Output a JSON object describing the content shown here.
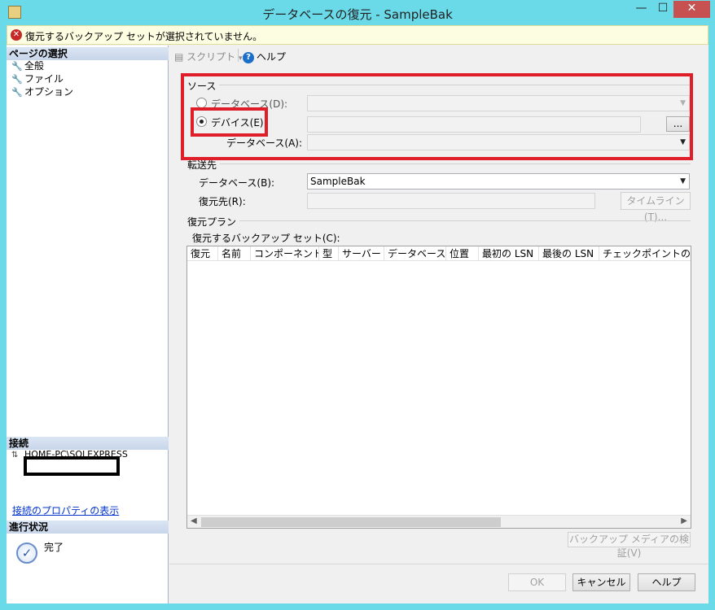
{
  "window": {
    "title": "データベースの復元 - SampleBak",
    "minimize_glyph": "—",
    "maximize_glyph": "☐",
    "close_glyph": "✕"
  },
  "error": {
    "icon": "error-icon",
    "message": "復元するバックアップ セットが選択されていません。"
  },
  "left": {
    "page_select_header": "ページの選択",
    "pages": [
      "全般",
      "ファイル",
      "オプション"
    ],
    "connection_header": "接続",
    "server": "HOME-PC\\SQLEXPRESS",
    "view_conn_props": "接続のプロパティの表示",
    "progress_header": "進行状況",
    "progress_status": "完了"
  },
  "toolbar": {
    "script_label": "スクリプト",
    "help_label": "ヘルプ"
  },
  "source": {
    "section": "ソース",
    "database_radio": "データベース(D):",
    "device_radio": "デバイス(E):",
    "browse_label": "...",
    "device_database_label": "データベース(A):",
    "selected": "device"
  },
  "destination": {
    "section": "転送先",
    "database_label": "データベース(B):",
    "database_value": "SampleBak",
    "restore_to_label": "復元先(R):",
    "timeline_button": "タイムライン(T)..."
  },
  "plan": {
    "section": "復元プラン",
    "backup_sets_label": "復元するバックアップ セット(C):",
    "columns": [
      "復元",
      "名前",
      "コンポーネント",
      "型",
      "サーバー",
      "データベース",
      "位置",
      "最初の LSN",
      "最後の LSN",
      "チェックポイントの LSN"
    ],
    "verify_button": "バックアップ メディアの検証(V)"
  },
  "footer": {
    "ok": "OK",
    "cancel": "キャンセル",
    "help": "ヘルプ"
  },
  "colors": {
    "title_bar": "#6ad9e8",
    "highlight_red": "#e01e2a",
    "error_red": "#c62828",
    "link_blue": "#0033cc"
  }
}
